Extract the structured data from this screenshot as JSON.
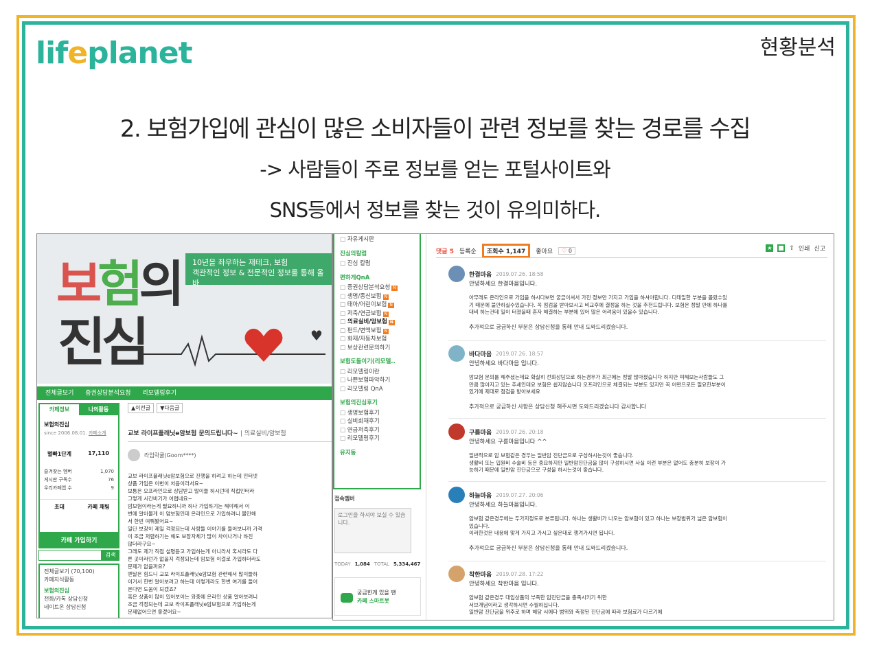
{
  "slide": {
    "logo_text_a": "lif",
    "logo_text_o": "e",
    "logo_text_b": "planet",
    "section_label": "현황분석",
    "headline": "2. 보험가입에 관심이 많은 소비자들이 관련 정보를 찾는 경로를 수집",
    "sub1": "-> 사람들이 주로 정보를 얻는 포털사이트와",
    "sub2": "SNS등에서 정보를 찾는 것이 유의미하다.",
    "colors": {
      "teal": "#2bb39c",
      "gold": "#f0b429",
      "green": "#2ea84a",
      "orange": "#f07c1f"
    }
  },
  "left_shot": {
    "banner_big1_a": "보",
    "banner_big1_b": "험",
    "banner_big1_c": "의",
    "banner_big2": "진심",
    "banner_tag_1": "10년을 좌우하는 재테크, 보험",
    "banner_tag_2": "객관적인 정보 & 전문적인 정보를 통해 올바",
    "nav": [
      "전체글보기",
      "증권상담분석요청",
      "리모델링후기"
    ],
    "cafe_tabs": [
      "카페정보",
      "나의활동"
    ],
    "cafe_name": "보험의진심",
    "cafe_since": "since 2006.08.01.",
    "cafe_intro": "카페소개",
    "stat_level": "별빠1단계",
    "stat_members": "17,110",
    "cafe_list": [
      {
        "label": "즐겨찾는 멤버",
        "value": "1,070"
      },
      {
        "label": "게시판 구독수",
        "value": "76"
      },
      {
        "label": "우리카페앱 수",
        "value": "9"
      }
    ],
    "invite": "초대",
    "chat": "카페 채팅",
    "join": "카페 가입하기",
    "search_btn": "검색",
    "menu_items": [
      "전체글보기 (70,100)",
      "카페지식활동"
    ],
    "menu_section": "보험의진심",
    "menu_items2": [
      "전화/카톡 상담신청",
      "네이트온 상담신청"
    ],
    "prev_btn": "▲이전글",
    "next_btn": "▼다음글",
    "post_title": "교보 라이프플래닛e암보험 문의드립니다~",
    "post_category": "| 의료실비/암보험",
    "post_author": "라임락쿨(Goom****)",
    "post_body": "교보 라이프플래닛e암보험으로 진행을 하려고 하는데 인터넷\n상품 가입은 이번이 처음이라서요~\n보통은 오프라인으로 상담받고 많이들 하시던데 직접인터라\n그렇게 시간비기가 어렵네요~\n암보험이라는게 필요하니까 하나 가입하기는 해야해서 이\n번에 알아볼게 이 암보험인데 온라인으로 가입하려니 불안해\n서 한번 여쭤봤어요~\n일단 보장이 제일 걱정되는데 사람들 이야기를 들어보니까 가격\n이 조금 저렴하기는 해도 보장자체가 많이 차이나거나 하진\n않더라구요~\n그래도 제가 직접 설명듣고 가입하는게 아니라서 혹시라도 다\n른 곳이라던가 없을지 걱정되는데 암보험 이걸로 가입하더라도\n문제가 없을까요?\n멘달은 힘드니 교보 라이프플래닛e암보험 관련해서 많이들하\n이거서 한번 알아보려고 하는데 이렇게라도 한번 여기를 들어\n온다면 도움이 되겠죠?\n혹은 상품이 많이 있어보이는 와중에 온라인 상품 알아보려니\n조금 걱정되는데 교보 라이프플래닛e암보험으로 가입하는게\n문제없어으면 좋겠어요~"
  },
  "right_shot": {
    "side_top": "자유게시판",
    "side_sections": [
      {
        "title": "진심의칼럼",
        "items": [
          {
            "t": "진심 칼럼",
            "n": ""
          }
        ]
      },
      {
        "title": "편하게QnA",
        "items": [
          {
            "t": "증권상담분석요청",
            "n": "N"
          },
          {
            "t": "생명/종신보험",
            "n": "N"
          },
          {
            "t": "태아/어린이보험",
            "n": "N"
          },
          {
            "t": "저축/연금보험",
            "n": "N"
          },
          {
            "t": "의료실비/암보험",
            "n": "N",
            "bold": true
          },
          {
            "t": "펀드/변액보험",
            "n": "N"
          },
          {
            "t": "화재/자동차보험",
            "n": ""
          },
          {
            "t": "보상관련문의하기",
            "n": ""
          }
        ]
      },
      {
        "title": "보험도돌이기(리모델..",
        "items": [
          {
            "t": "리모델링이란",
            "n": ""
          },
          {
            "t": "나쁜보험파악하기",
            "n": ""
          },
          {
            "t": "리모델링 QnA",
            "n": ""
          }
        ]
      },
      {
        "title": "보험의진심후기",
        "items": [
          {
            "t": "생명보험후기",
            "n": ""
          },
          {
            "t": "실비회재후기",
            "n": ""
          },
          {
            "t": "연금저축후기",
            "n": ""
          },
          {
            "t": "리모델링후기",
            "n": ""
          }
        ]
      }
    ],
    "side_bottom": "유지동",
    "login_title": "접속멤버",
    "login_msg": "로그인을 하셔야 보실 수 있습니다.",
    "today_label": "TODAY",
    "today_val": "1,084",
    "total_label": "TOTAL",
    "total_val": "5,334,467",
    "bot_line1": "궁금한게 있을 땐",
    "bot_line2": "카페 스마트봇",
    "comment_count_label": "댓글 5",
    "sort_label": "등록순",
    "views_label": "조회수 1,147",
    "likes_label": "좋아요",
    "likes_count": "0",
    "print_label": "인쇄",
    "report_label": "신고",
    "comments": [
      {
        "nick": "한결마음",
        "date": "2019.07.26. 18:58",
        "greet": "안녕하세요 한결마음입니다.",
        "body": "아무래도 온라인으로 가입을 하시다보면 궁금이셔서 가진 정보만 가지고 가입을 하셔야합니다. 디테일한 부분을 몰랐수있\n기 때문에 불안하실수있습니다. 꼭 점검을 받아보시고 비교후에 결정을 하는 것을 추천드립니다. 보험은 정말 만에 하나를\n대비 하는건데 일이 터졌을때 혼자 해결하는 부분에 있어 많은 어려움이 있을수 있습니다.",
        "foot": "추가적으로 궁금하신 부분은 상담신청을 통해 안내 도와드리겠습니다."
      },
      {
        "nick": "바다마음",
        "date": "2019.07.26. 18:57",
        "greet": "안녕하세요 바다마음 입니다.",
        "body": "암보험 문의를 해주셨는데요 확실히 전화상담으로 하는경우가 최근에는 정말 많아졌습니다 하지만 피해보는사람들도 그\n만큼 많아지고 있는 추세인데요 보험은 쉽지않습니다 오프라인으로 체결되는 부분도 있지만 꼭 어떤으로든 필요한부분이\n있기에 제대로 점검을 받아보세요",
        "foot": "추가적으로 궁금하신 사항은 상담신청 해주시면 도와드리겠습니다 감사합니다"
      },
      {
        "nick": "구름마음",
        "date": "2019.07.26. 20:18",
        "greet": "안녕하세요 구름마음입니다 ^^",
        "body": "일반적으로 암 보험같은 경우는 일반암 진단금으로 구성하시는것이 좋습니다.\n생활비 또는 입원비 수술비 등은 중요하지만 일반암진단금을 많이 구성하시면 사실 이런 부분은 없어도 충분히 보장이 가\n능하기 때문에 일반암 진단금으로 구성을 하시는것이 좋습니다.",
        "foot": ""
      },
      {
        "nick": "하늘마음",
        "date": "2019.07.27. 20:06",
        "greet": "안녕하세요 하늘마음입니다.",
        "body": "암보험 같은경우에는 두가지정도로 분류됩니다. 하나는 생활비가 나오는 암보험이 있고 하나는 보장범위가 넓은 암보험이\n있습니다.\n이러한것은 내용에 맞게 가지고 가시고 싶은대로 챙겨가시면 됩니다.",
        "foot": "추가적으로 궁금하신 부분은 상담신청을 통해 안내 도와드리겠습니다."
      },
      {
        "nick": "착한마음",
        "date": "2019.07.28. 17:22",
        "greet": "안녕하세요 착한마음 입니다.",
        "body": "암보험 같은경우 대입상품의 부족한 암진단금을 충족시키기 위한\n서브개념이라고 생각하시면 수월하십니다.\n일반암 진단금을 위주로 하며 해당 시에다 범위와 측정된 진단금에 따라 보험료가 다르기에\n",
        "foot": ""
      }
    ]
  }
}
